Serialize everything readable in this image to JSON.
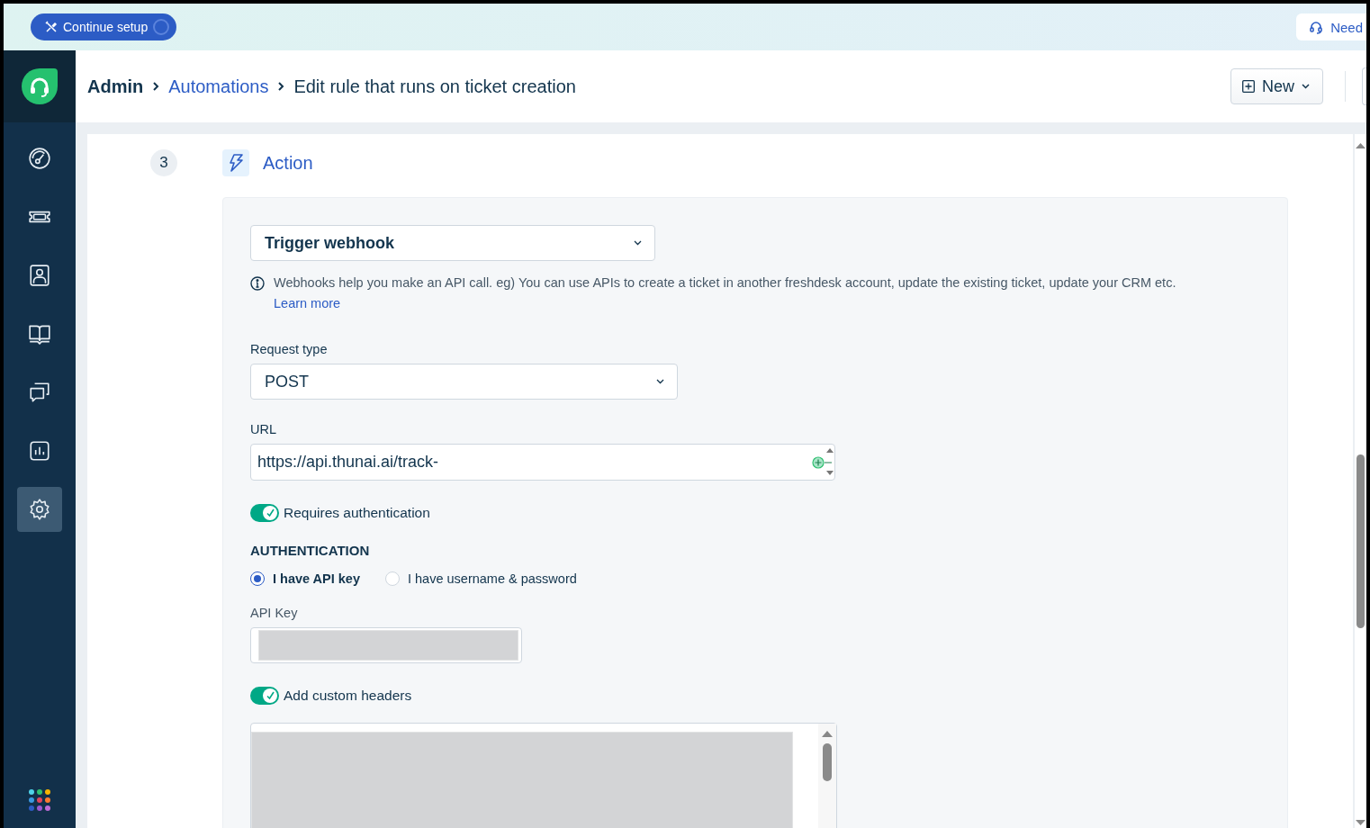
{
  "banner": {
    "setup_button": "Continue setup",
    "help_button": "Need"
  },
  "sidebar": {
    "items": [
      {
        "selected": false
      },
      {
        "selected": false
      },
      {
        "selected": false
      },
      {
        "selected": false
      },
      {
        "selected": false
      },
      {
        "selected": false
      },
      {
        "selected": true
      }
    ]
  },
  "breadcrumb": [
    {
      "label": "Admin",
      "kind": "root"
    },
    {
      "label": "Automations",
      "kind": "link"
    },
    {
      "label": "Edit rule that runs on ticket creation",
      "kind": "current"
    }
  ],
  "header": {
    "new_button": "New"
  },
  "step": {
    "number": "3",
    "title": "Action"
  },
  "action": {
    "type": "Trigger webhook",
    "info": "Webhooks help you make an API call. eg) You can use APIs to create a ticket in another freshdesk account, update the existing ticket, update your CRM etc.",
    "learn_more": "Learn more",
    "request_type": {
      "label": "Request type",
      "value": "POST"
    },
    "url": {
      "label": "URL",
      "value": "https://api.thunai.ai/track-"
    },
    "requires_auth": {
      "label": "Requires authentication",
      "on": true
    },
    "authentication": {
      "heading": "AUTHENTICATION",
      "options": [
        {
          "label": "I have API key",
          "selected": true
        },
        {
          "label": "I have username & password",
          "selected": false
        }
      ]
    },
    "api_key": {
      "label": "API Key"
    },
    "custom_headers": {
      "label": "Add custom headers",
      "on": true
    }
  }
}
